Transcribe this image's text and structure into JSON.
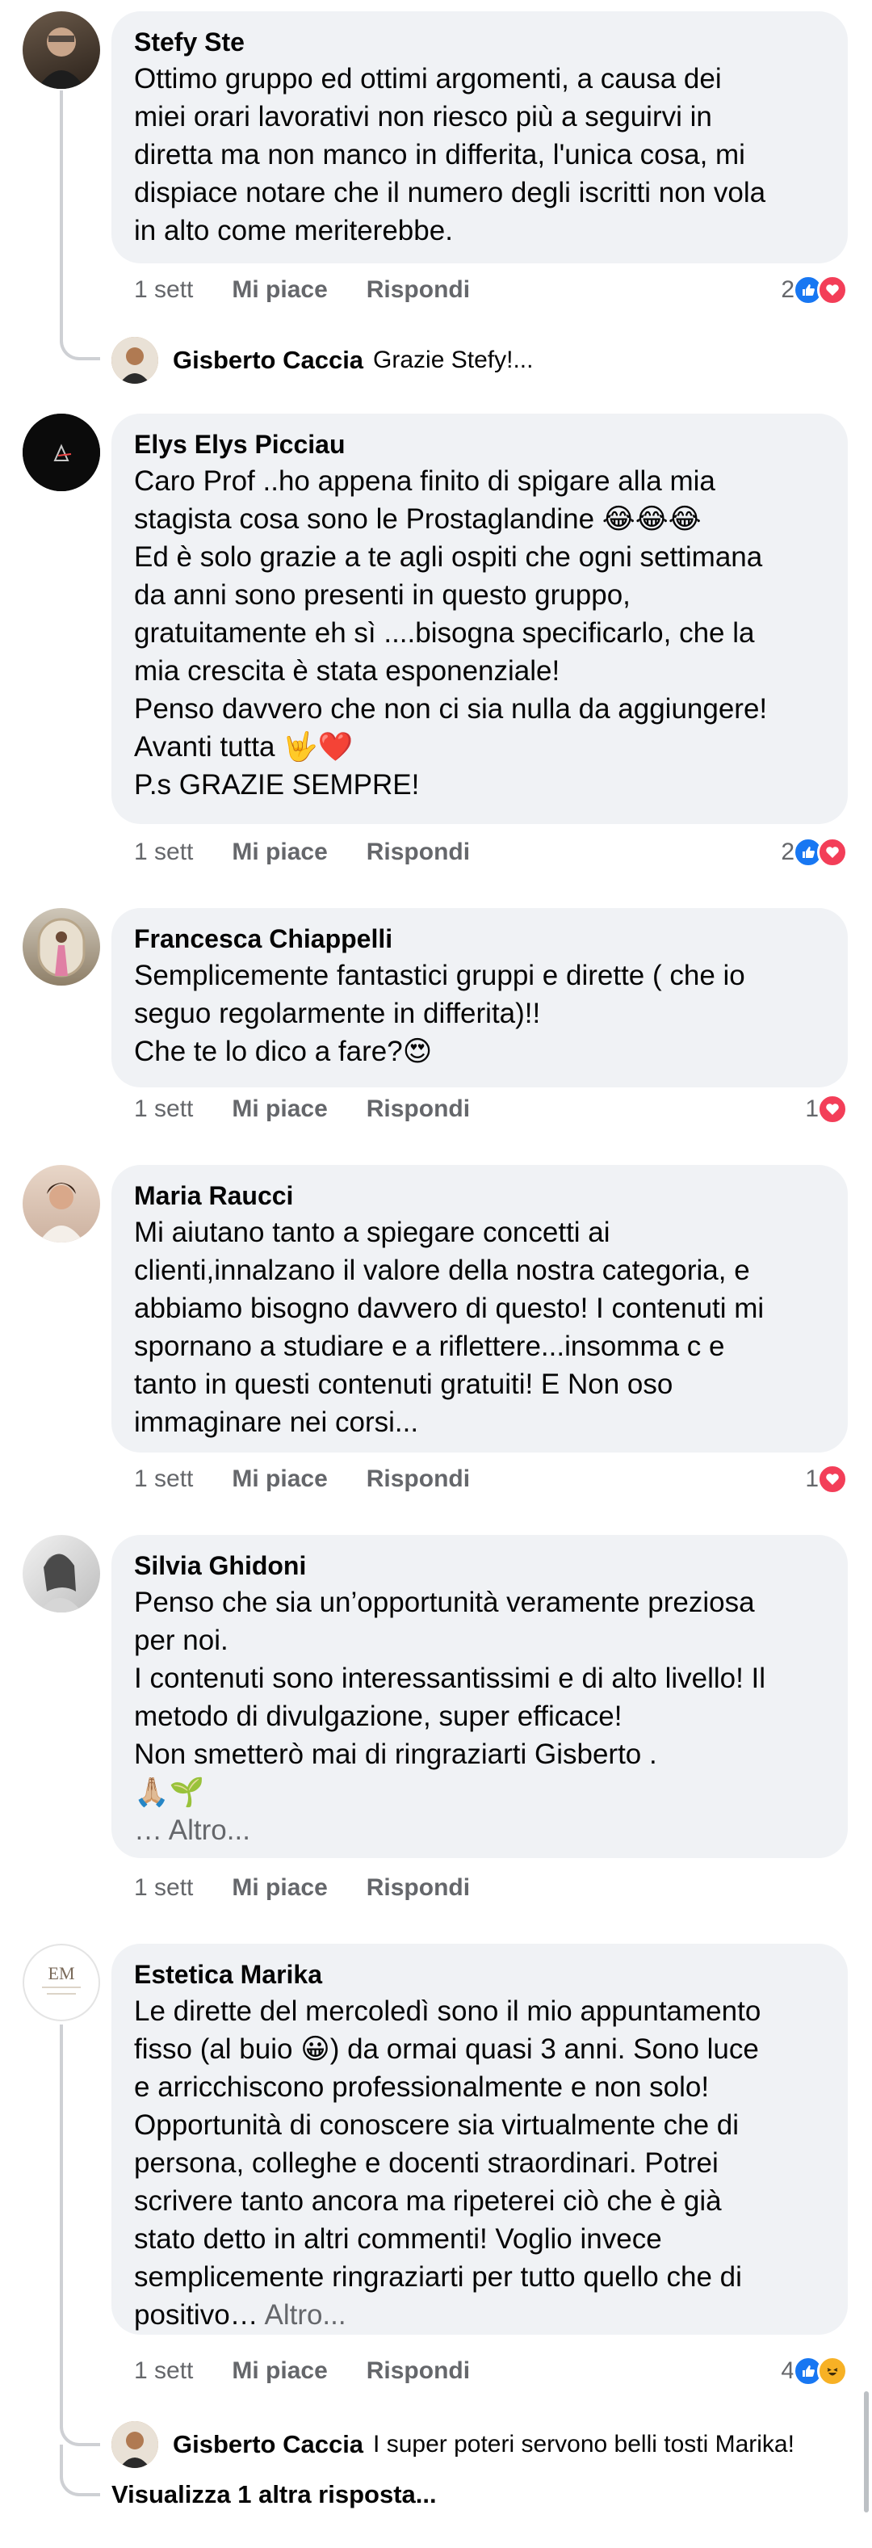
{
  "comments": [
    {
      "author": "Stefy Ste",
      "text": "Ottimo gruppo ed ottimi argomenti, a causa dei\nmiei orari lavorativi non riesco più a seguirvi in\ndiretta ma non manco in differita, l'unica cosa, mi\ndispiace  notare che il numero degli iscritti non vola\nin alto come meriterebbe.",
      "time": "1 sett",
      "like_label": "Mi piace",
      "reply_label": "Rispondi",
      "reaction_count": "2",
      "reactions": [
        "like-icon",
        "love-icon"
      ],
      "reply": {
        "author": "Gisberto Caccia",
        "text": "Grazie Stefy!..."
      }
    },
    {
      "author": "Elys Elys Picciau",
      "text": "Caro Prof ..ho appena finito di spigare alla mia\nstagista cosa sono le Prostaglandine 😂😂😂\nEd è solo grazie a te agli ospiti che ogni settimana\nda anni sono presenti in questo gruppo,\ngratuitamente eh sì ....bisogna specificarlo, che la\nmia crescita è stata esponenziale!\nPenso davvero che non ci sia nulla da aggiungere!\nAvanti tutta 🤟❤️\nP.s  GRAZIE SEMPRE!",
      "time": "1 sett",
      "like_label": "Mi piace",
      "reply_label": "Rispondi",
      "reaction_count": "2",
      "reactions": [
        "like-icon",
        "love-icon"
      ]
    },
    {
      "author": "Francesca Chiappelli",
      "text": "Semplicemente fantastici gruppi e dirette ( che io\nseguo regolarmente in differita)!!\nChe te lo dico a fare?😍",
      "time": "1 sett",
      "like_label": "Mi piace",
      "reply_label": "Rispondi",
      "reaction_count": "1",
      "reactions": [
        "love-icon"
      ]
    },
    {
      "author": "Maria Raucci",
      "text": "Mi aiutano tanto a spiegare concetti ai\nclienti,innalzano il valore della nostra categoria, e\nabbiamo bisogno davvero di questo! I contenuti mi\nspornano a studiare e a riflettere...insomma c e\ntanto in questi contenuti gratuiti! E Non oso\nimmaginare nei corsi...",
      "time": "1 sett",
      "like_label": "Mi piace",
      "reply_label": "Rispondi",
      "reaction_count": "1",
      "reactions": [
        "love-icon"
      ]
    },
    {
      "author": "Silvia Ghidoni",
      "text": "Penso che sia un’opportunità veramente preziosa\nper noi.\nI contenuti sono interessantissimi e di alto livello! Il\nmetodo di divulgazione, super efficace!\nNon smetterò mai di ringraziarti Gisberto .\n🙏🏼🌱",
      "more": "… Altro...",
      "time": "1 sett",
      "like_label": "Mi piace",
      "reply_label": "Rispondi"
    },
    {
      "author": "Estetica Marika",
      "text": "Le dirette del mercoledì sono il mio appuntamento\nfisso (al buio 😀) da ormai  quasi 3 anni. Sono luce\ne arricchiscono professionalmente e non solo!\nOpportunità di conoscere sia virtualmente che di\npersona, colleghe e docenti straordinari. Potrei\nscrivere tanto ancora ma ripeterei ciò che è già\nstato detto in altri commenti! Voglio invece\nsemplicemente ringraziarti per tutto quello che di\npositivo…",
      "more": "Altro...",
      "time": "1 sett",
      "like_label": "Mi piace",
      "reply_label": "Rispondi",
      "reaction_count": "4",
      "reactions": [
        "like-icon",
        "haha-icon"
      ],
      "reply": {
        "author": "Gisberto Caccia",
        "text": "I super poteri servono belli tosti Marika!"
      },
      "view_more_replies": "Visualizza 1 altra risposta..."
    }
  ],
  "avatar_logo_text": "EM"
}
